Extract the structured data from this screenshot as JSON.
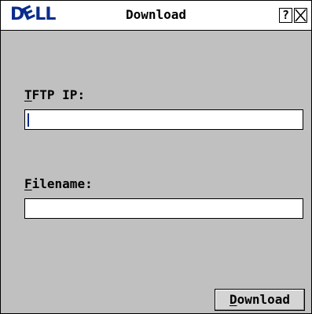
{
  "window": {
    "logo": {
      "before_e": "D",
      "e": "E",
      "after_e": "LL"
    },
    "title": "Download",
    "help_label": "?",
    "close_icon": "close-x-icon"
  },
  "form": {
    "tftp_ip": {
      "label_mnemonic": "T",
      "label_rest": "FTP IP:",
      "value": ""
    },
    "filename": {
      "label_mnemonic": "F",
      "label_rest": "ilename:",
      "value": ""
    }
  },
  "actions": {
    "download_mnemonic": "D",
    "download_rest": "ownload"
  },
  "colors": {
    "brand": "#0a2c8c",
    "background": "#c0c0c0",
    "titlebar": "#ffffff"
  }
}
